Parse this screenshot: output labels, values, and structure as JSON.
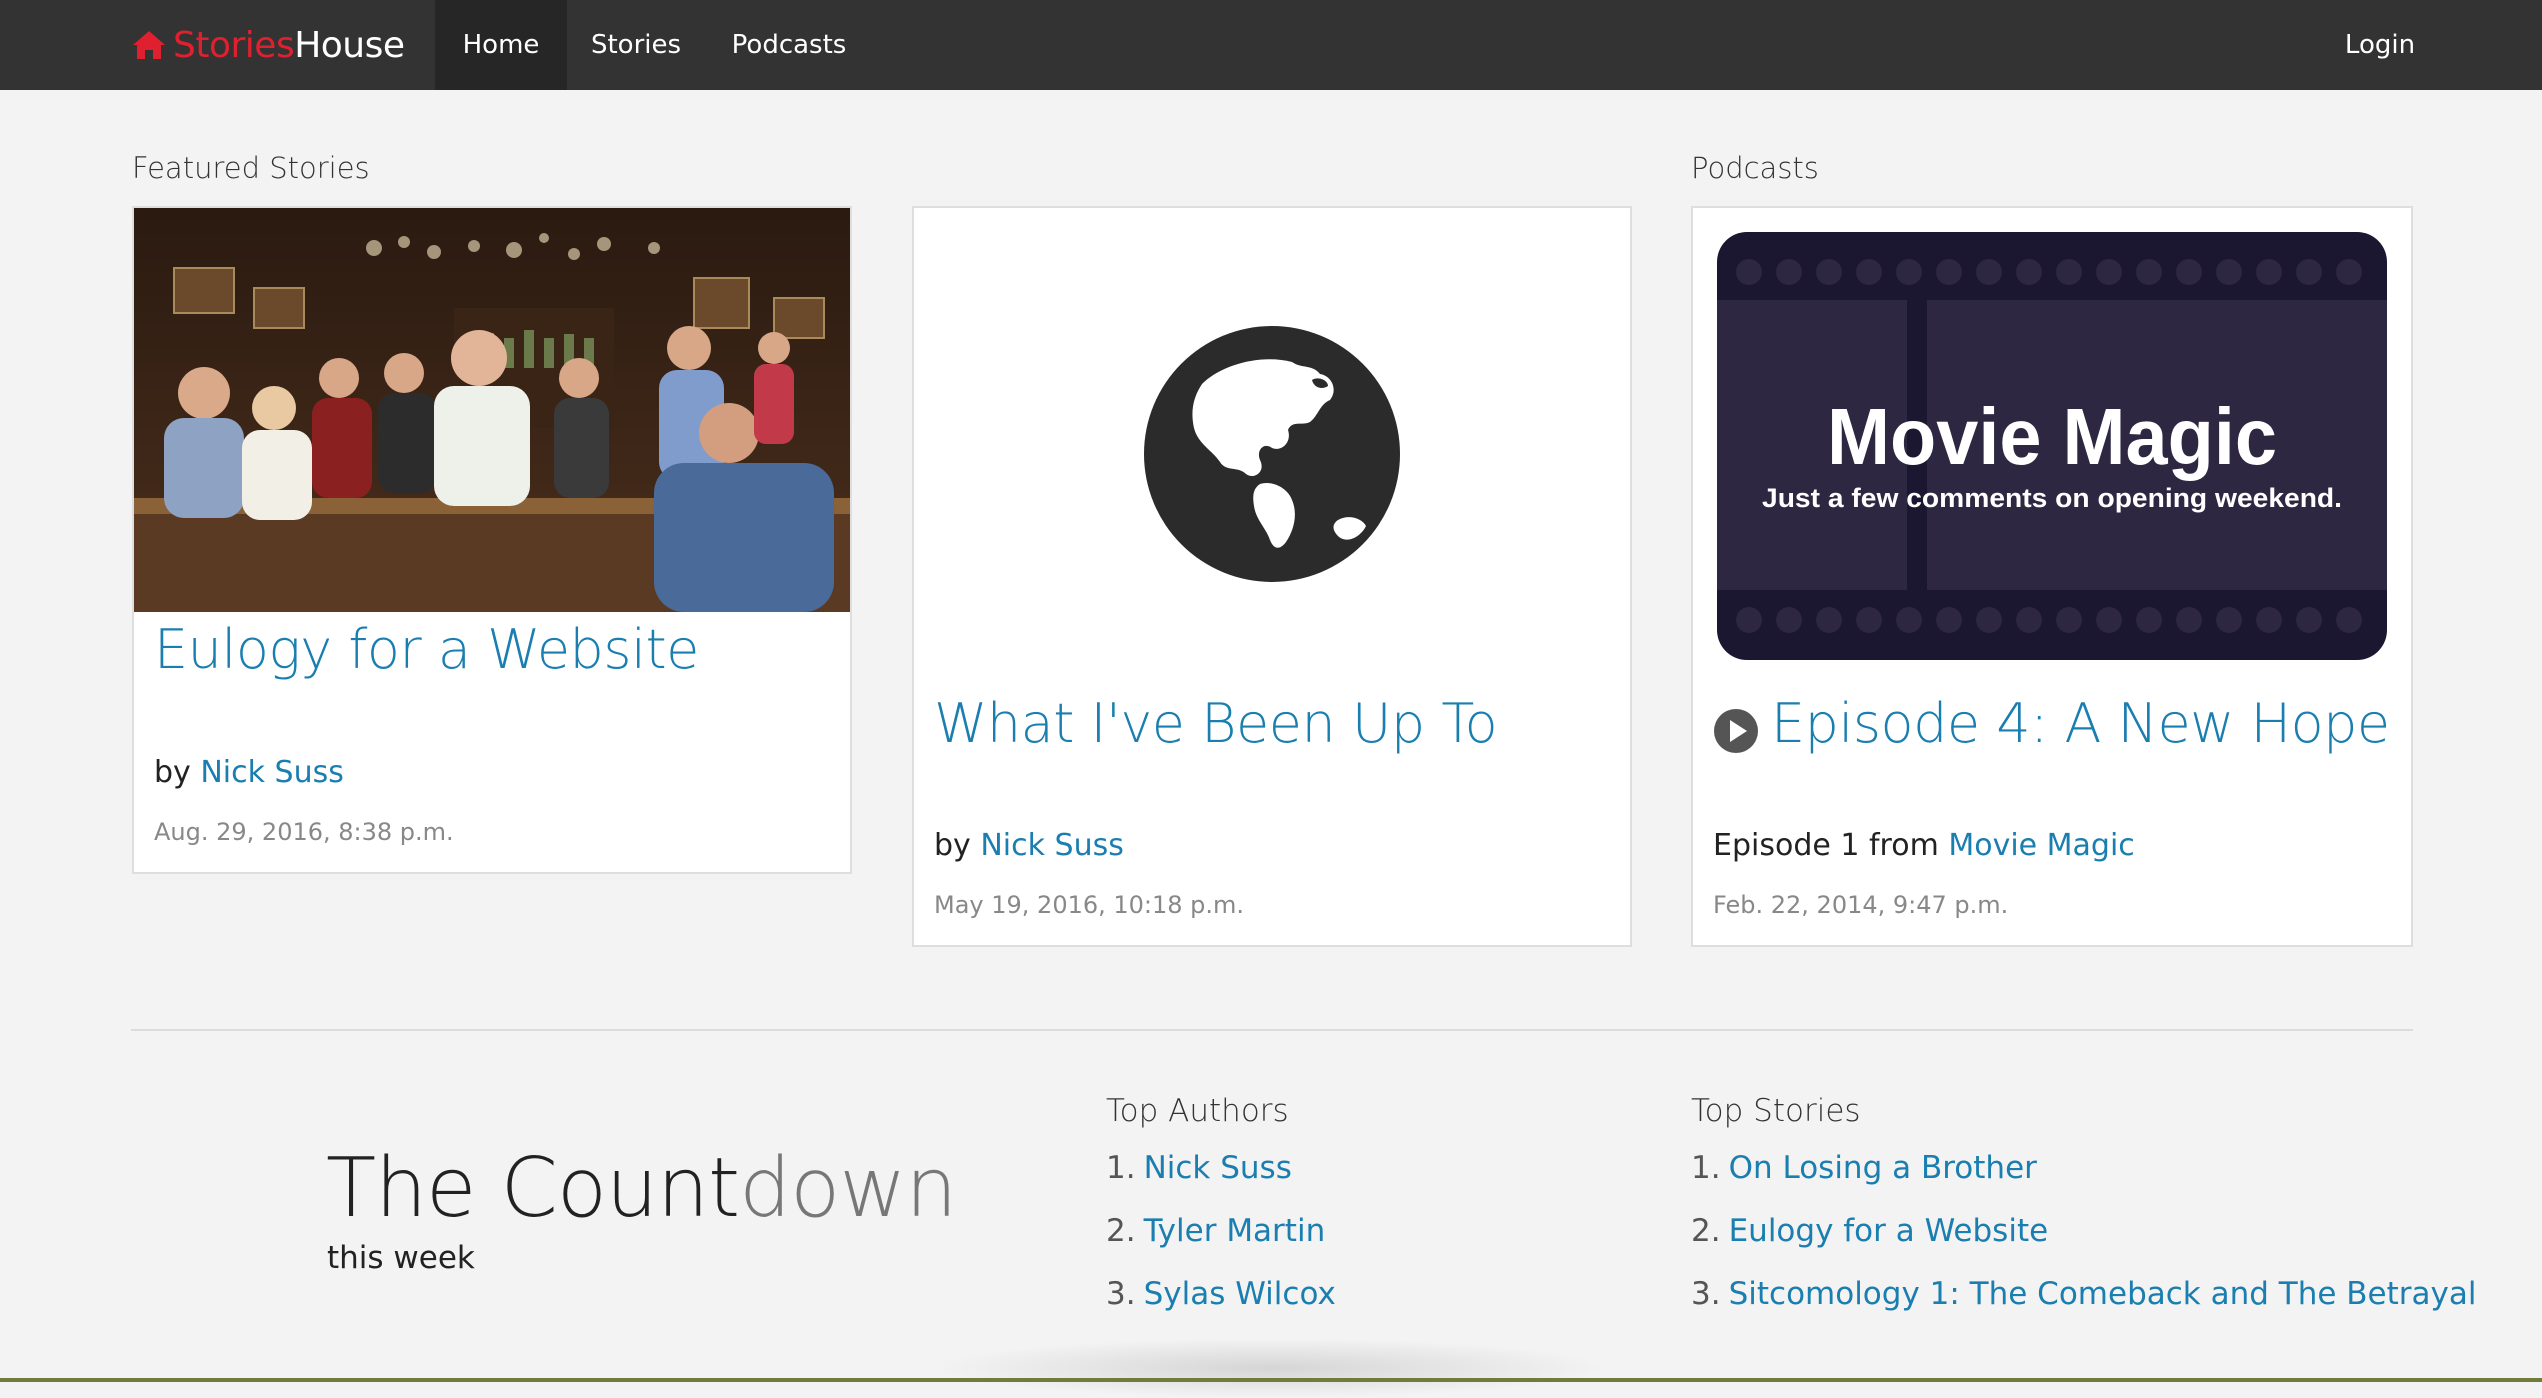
{
  "navbar": {
    "brand_part1": "Stories",
    "brand_part2": "House",
    "items": [
      {
        "label": "Home",
        "active": true
      },
      {
        "label": "Stories",
        "active": false
      },
      {
        "label": "Podcasts",
        "active": false
      }
    ],
    "login_label": "Login"
  },
  "featured": {
    "heading": "Featured Stories",
    "cards": [
      {
        "image": "bar-scene-photo",
        "title": "Eulogy for a Website",
        "by_prefix": "by",
        "author": "Nick Suss",
        "date": "Aug. 29, 2016, 8:38 p.m."
      },
      {
        "image": "globe-icon",
        "title": "What I've Been Up To",
        "by_prefix": "by",
        "author": "Nick Suss",
        "date": "May 19, 2016, 10:18 p.m."
      }
    ]
  },
  "podcasts": {
    "heading": "Podcasts",
    "card": {
      "image_title": "Movie Magic",
      "image_subtitle": "Just a few comments on opening weekend.",
      "title": "Episode 4: A New Hope",
      "episode_prefix": "Episode 1 from",
      "show": "Movie Magic",
      "date": "Feb. 22, 2014, 9:47 p.m."
    }
  },
  "countdown": {
    "title_part1": "The Count",
    "title_part2": "down",
    "subtitle": "this week"
  },
  "top_authors": {
    "heading": "Top Authors",
    "items": [
      {
        "num": "1.",
        "label": "Nick Suss"
      },
      {
        "num": "2.",
        "label": "Tyler Martin"
      },
      {
        "num": "3.",
        "label": "Sylas Wilcox"
      }
    ]
  },
  "top_stories": {
    "heading": "Top Stories",
    "items": [
      {
        "num": "1.",
        "label": "On Losing a Brother"
      },
      {
        "num": "2.",
        "label": "Eulogy for a Website"
      },
      {
        "num": "3.",
        "label": "Sitcomology 1: The Comeback and The Betrayal"
      }
    ]
  },
  "colors": {
    "navbar": "#333333",
    "brand_red": "#e0202f",
    "link": "#1a7eb0",
    "page_bg": "#f3f3f3"
  }
}
